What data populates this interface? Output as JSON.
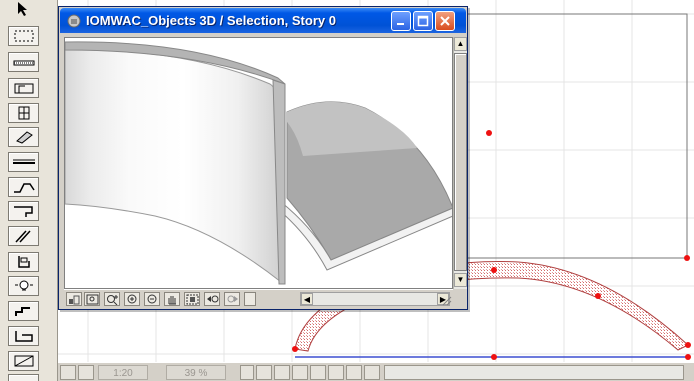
{
  "window": {
    "title": "IOMWAC_Objects 3D / Selection, Story 0",
    "title_icon": "archicad-3d-window-icon",
    "buttons": {
      "minimize": "minimize-icon",
      "maximize": "maximize-icon",
      "close": "close-icon"
    }
  },
  "toolbox": {
    "tools": [
      "arrow-tool-icon",
      "marquee-tool-icon",
      "wall-tool-icon",
      "door-tool-icon",
      "window-tool-icon",
      "column-tool-icon",
      "beam-tool-icon",
      "slab-tool-icon",
      "stair-tool-icon",
      "roof-tool-icon",
      "mesh-tool-icon",
      "object-tool-icon",
      "lamp-tool-icon",
      "stair-object-icon",
      "zone-tool-icon",
      "fill-tool-icon"
    ]
  },
  "window_toolbar": {
    "tools": [
      "3d-view-settings-icon",
      "fit-in-window-icon",
      "zoom-plus-minus-icon",
      "zoom-in-icon",
      "zoom-out-icon",
      "pan-hand-icon",
      "fit-selection-icon",
      "previous-zoom-icon",
      "next-zoom-icon"
    ]
  },
  "plan_status": {
    "scale": "1:20",
    "zoom": "39 %"
  },
  "colors": {
    "titlebar": "#0058e6",
    "selection_point": "#ff0000",
    "plan_line": "#3d4fd0",
    "hatch": "#e8a0a0"
  }
}
